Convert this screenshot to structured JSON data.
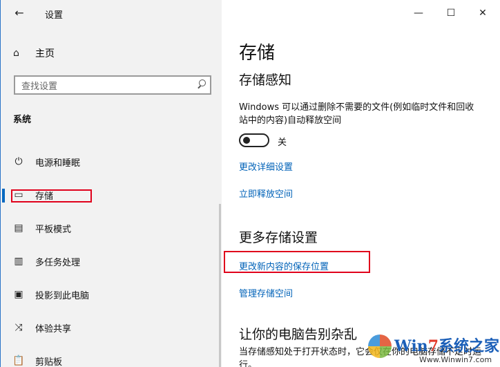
{
  "window": {
    "title": "设置",
    "back_icon": "←",
    "minimize_icon": "—",
    "maximize_icon": "☐",
    "close_icon": "✕"
  },
  "sidebar": {
    "home": {
      "icon": "⌂",
      "label": "主页"
    },
    "search": {
      "placeholder": "查找设置",
      "icon": "search-icon"
    },
    "section": "系统",
    "items": [
      {
        "label": "电源和睡眠",
        "icon": "⏻"
      },
      {
        "label": "存储",
        "icon": "▭",
        "active": true
      },
      {
        "label": "平板模式",
        "icon": "▤"
      },
      {
        "label": "多任务处理",
        "icon": "▥"
      },
      {
        "label": "投影到此电脑",
        "icon": "▣"
      },
      {
        "label": "体验共享",
        "icon": "⤨"
      },
      {
        "label": "剪贴板",
        "icon": "📋"
      }
    ]
  },
  "main": {
    "title": "存储",
    "storage_sense": {
      "heading": "存储感知",
      "description": "Windows 可以通过删除不需要的文件(例如临时文件和回收站中的内容)自动释放空间",
      "toggle_state": "关",
      "toggle_on": false,
      "link_change": "更改详细设置",
      "link_free": "立即释放空间"
    },
    "more_settings": {
      "heading": "更多存储设置",
      "link_save_location": "更改新内容的保存位置",
      "link_manage": "管理存储空间"
    },
    "declutter": {
      "heading": "让你的电脑告别杂乱",
      "text": "当存储感知处于打开状态时，它会仅在你的电脑存储不足时运行。"
    }
  },
  "watermark": {
    "brand_left": "Win",
    "brand_seven": "7",
    "brand_right": "系统之家",
    "url": "Www.Winwin7.com"
  },
  "colors": {
    "accent": "#0067c0",
    "link": "#0062b8",
    "highlight_box": "#e0001b",
    "sidebar_bg": "#f2f2f2"
  }
}
